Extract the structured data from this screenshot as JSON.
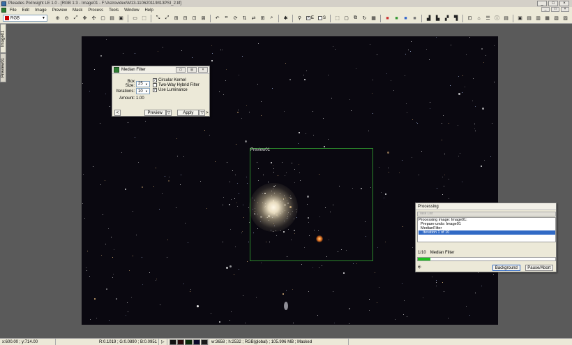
{
  "app": {
    "title": "Pleiades PixInsight LE 1.0 - [RGB 1:3 - Image01 - F:\\Astrovideo\\M13-11062011\\M13PSI_2.tif]",
    "window_controls": [
      "_",
      "□",
      "×"
    ]
  },
  "menu": [
    "File",
    "Edit",
    "Image",
    "Preview",
    "Mask",
    "Process",
    "Tools",
    "Window",
    "Help"
  ],
  "mdi_controls": [
    "_",
    "□",
    "×"
  ],
  "toolbar": {
    "color_mode": "RGB",
    "checks": [
      {
        "label": "E",
        "checked": true
      },
      {
        "label": "S",
        "checked": false
      }
    ],
    "icons": [
      "new-icon",
      "open-icon",
      "save-icon",
      "cut-icon",
      "copy-icon",
      "paste-icon",
      "undo-icon",
      "redo-icon",
      "zoom-in-icon",
      "zoom-out-icon",
      "fit-icon",
      "crop-icon",
      "rotate-icon",
      "flip-icon",
      "mirror-icon",
      "histogram-icon",
      "curves-icon",
      "color-icon",
      "process-icon",
      "pin-icon"
    ]
  },
  "side_tabs": [
    "Image01",
    "Preview01"
  ],
  "image": {
    "preview_label": "Preview01"
  },
  "median_filter": {
    "title": "Median Filter",
    "box_size_label": "Box Size:",
    "box_size_value": "25",
    "iterations_label": "Iterations:",
    "iterations_value": "10",
    "amount_label": "Amount:",
    "amount_value": "1.00",
    "checks": [
      {
        "label": "Circular Kernel",
        "checked": true
      },
      {
        "label": "Two-Way Hybrid Filter",
        "checked": false
      },
      {
        "label": "Use Luminance",
        "checked": true
      }
    ],
    "preview_label": "Preview",
    "apply_label": "Apply",
    "nav_left": "<",
    "nav_right": ">"
  },
  "processing": {
    "title": "Processing",
    "sub_header": "Task List",
    "log": [
      "Processing image: Image01:",
      "  Prepare undo: Image01",
      "  MedianFilter",
      "    Iteration 1 of 10"
    ],
    "progress_fraction": 0.09,
    "progress_counter": "1/10",
    "progress_task": "Median Filter",
    "background_label": "Background",
    "pause_label": "Pause/Abort"
  },
  "status": {
    "coords": "x:600.00 ; y:714.00",
    "rgb": "R:0.1019 ; G:0.0890 ; B:0.0951",
    "play_icon": "▷",
    "info": "w:3658 ; h:2532 ; RGB(global) ; 105.996 MB ; Masked",
    "swatches": [
      "#111111",
      "#2a0a0a",
      "#0a2a0a",
      "#0a0a2a",
      "#1a1a1a"
    ]
  }
}
